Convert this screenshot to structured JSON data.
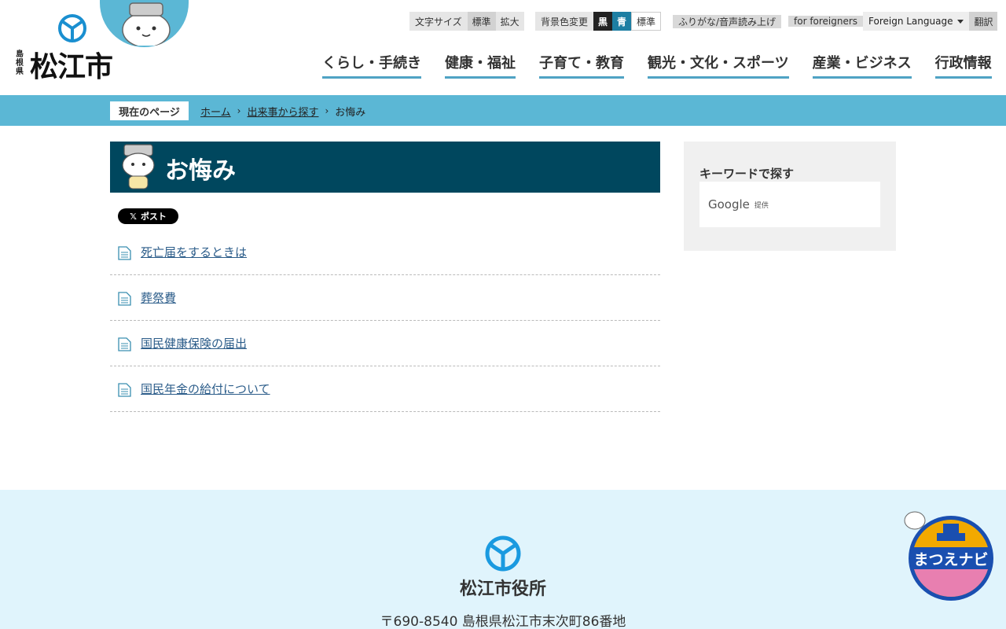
{
  "site": {
    "prefecture": "島根県",
    "city": "松江市"
  },
  "toolbar": {
    "font_size_label": "文字サイズ",
    "font_standard": "標準",
    "font_large": "拡大",
    "bg_label": "背景色変更",
    "bg_black": "黒",
    "bg_blue": "青",
    "bg_standard": "標準",
    "furigana": "ふりがな/音声読み上げ",
    "foreigners": "for foreigners",
    "foreign_language": "Foreign Language",
    "translate": "翻訳"
  },
  "gnav": [
    "くらし・手続き",
    "健康・福祉",
    "子育て・教育",
    "観光・文化・スポーツ",
    "産業・ビジネス",
    "行政情報"
  ],
  "breadcrumb": {
    "label": "現在のページ",
    "items": [
      "ホーム",
      "出来事から探す"
    ],
    "current": "お悔み"
  },
  "page": {
    "title": "お悔み",
    "share_label": "ポスト",
    "links": [
      "死亡届をするときは",
      "葬祭費",
      "国民健康保険の届出",
      "国民年金の給付について"
    ]
  },
  "sidebar": {
    "keyword_title": "キーワードで探す",
    "google": "Google",
    "provided": "提供"
  },
  "footer": {
    "office": "松江市役所",
    "address": "〒690-8540 島根県松江市末次町86番地",
    "navi": "まつえナビ"
  },
  "colors": {
    "accent": "#5bb7d5",
    "title_bg": "#00475e",
    "footer_bg": "#e0f4fc",
    "link": "#2c5d8a"
  }
}
